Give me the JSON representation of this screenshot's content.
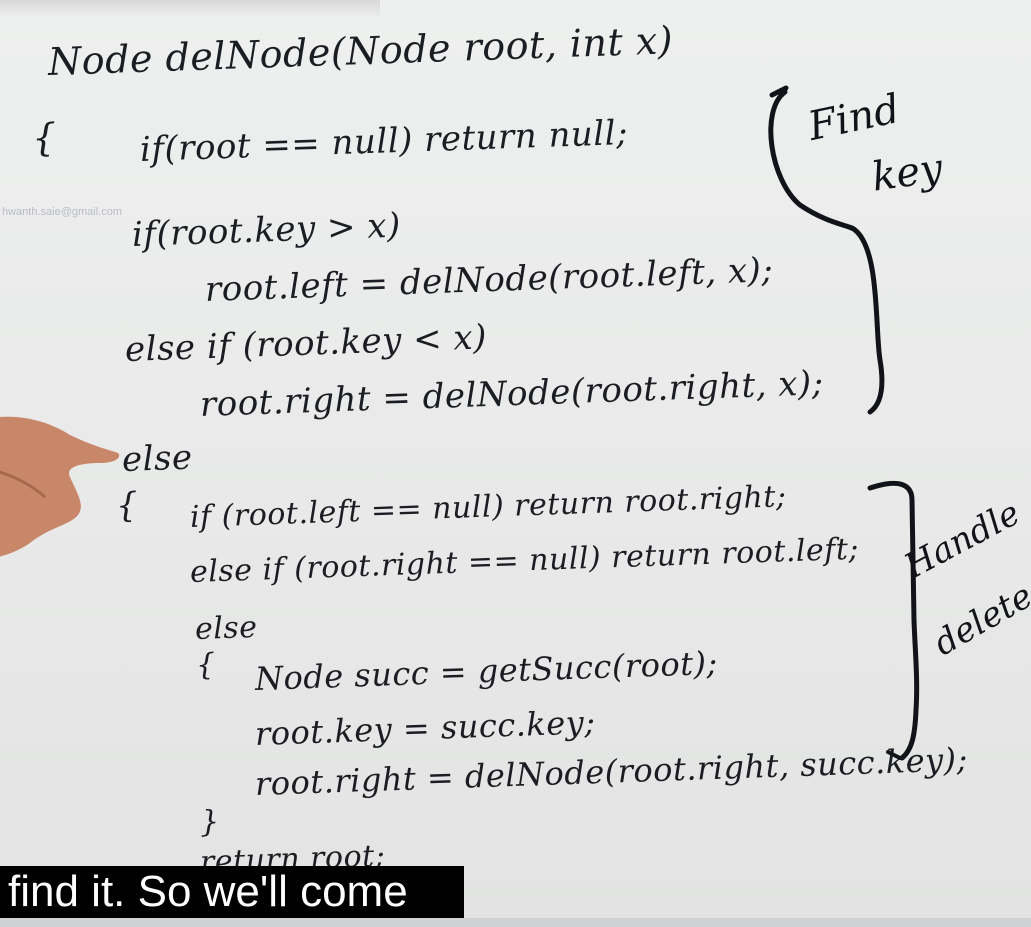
{
  "board": {
    "watermark": "hwanth.saie@gmail.com",
    "code_lines": [
      "Node delNode(Node root, int x)",
      "{",
      "if(root == null) return null;",
      "if(root.key > x)",
      "root.left = delNode(root.left, x);",
      "else if (root.key < x)",
      "root.right = delNode(root.right, x);",
      "else",
      "{",
      "if (root.left == null) return root.right;",
      "else if (root.right == null) return root.left;",
      "else",
      "{",
      "Node succ = getSucc(root);",
      "root.key = succ.key;",
      "root.right = delNode(root.right, succ.key);",
      "}",
      "return root;"
    ],
    "notes": {
      "find_key_line1": "Find",
      "find_key_line2": "key",
      "handle_delete_line1": "Handle",
      "handle_delete_line2": "delete"
    }
  },
  "caption": {
    "text": "find it. So we'll come"
  },
  "colors": {
    "ink": "#1b1d22",
    "board": "#eceded",
    "caption_bg": "#000000",
    "caption_fg": "#ffffff"
  }
}
